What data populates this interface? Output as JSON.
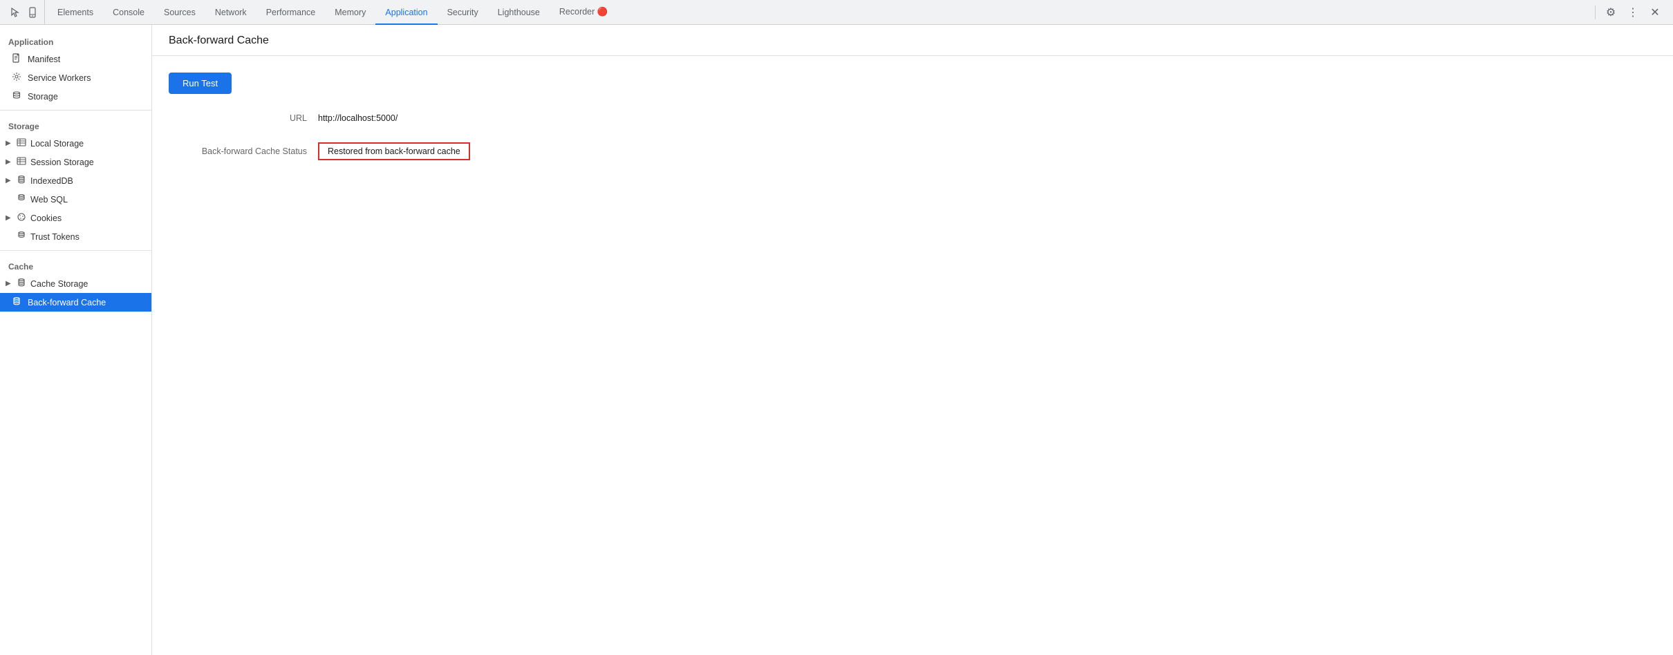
{
  "tabs": {
    "items": [
      {
        "id": "elements",
        "label": "Elements",
        "active": false
      },
      {
        "id": "console",
        "label": "Console",
        "active": false
      },
      {
        "id": "sources",
        "label": "Sources",
        "active": false
      },
      {
        "id": "network",
        "label": "Network",
        "active": false
      },
      {
        "id": "performance",
        "label": "Performance",
        "active": false
      },
      {
        "id": "memory",
        "label": "Memory",
        "active": false
      },
      {
        "id": "application",
        "label": "Application",
        "active": true
      },
      {
        "id": "security",
        "label": "Security",
        "active": false
      },
      {
        "id": "lighthouse",
        "label": "Lighthouse",
        "active": false
      },
      {
        "id": "recorder",
        "label": "Recorder 🔴",
        "active": false
      }
    ]
  },
  "sidebar": {
    "application_section": "Application",
    "application_items": [
      {
        "id": "manifest",
        "label": "Manifest",
        "icon": "doc"
      },
      {
        "id": "service-workers",
        "label": "Service Workers",
        "icon": "gear"
      },
      {
        "id": "storage",
        "label": "Storage",
        "icon": "db"
      }
    ],
    "storage_section": "Storage",
    "storage_items": [
      {
        "id": "local-storage",
        "label": "Local Storage",
        "icon": "table",
        "expandable": true
      },
      {
        "id": "session-storage",
        "label": "Session Storage",
        "icon": "table",
        "expandable": true
      },
      {
        "id": "indexeddb",
        "label": "IndexedDB",
        "icon": "db",
        "expandable": true
      },
      {
        "id": "web-sql",
        "label": "Web SQL",
        "icon": "db",
        "expandable": false
      },
      {
        "id": "cookies",
        "label": "Cookies",
        "icon": "cookie",
        "expandable": true
      },
      {
        "id": "trust-tokens",
        "label": "Trust Tokens",
        "icon": "db",
        "expandable": false
      }
    ],
    "cache_section": "Cache",
    "cache_items": [
      {
        "id": "cache-storage",
        "label": "Cache Storage",
        "icon": "db",
        "expandable": true
      },
      {
        "id": "back-forward-cache",
        "label": "Back-forward Cache",
        "icon": "db",
        "active": true
      }
    ]
  },
  "content": {
    "title": "Back-forward Cache",
    "run_test_label": "Run Test",
    "url_label": "URL",
    "url_value": "http://localhost:5000/",
    "status_label": "Back-forward Cache Status",
    "status_value": "Restored from back-forward cache"
  },
  "icons": {
    "gear": "⚙",
    "more": "⋮",
    "close": "✕",
    "cursor": "⬡",
    "mobile": "▭"
  }
}
